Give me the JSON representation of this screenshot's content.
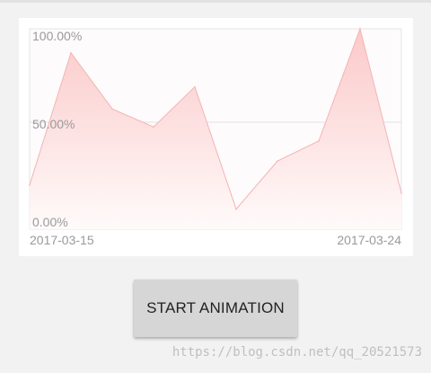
{
  "chart_data": {
    "type": "area",
    "x_labels": [
      "2017-03-15",
      "2017-03-24"
    ],
    "y_tick_labels": [
      "100.00%",
      "50.00%",
      "0.00%"
    ],
    "values_percent": [
      22,
      88,
      60,
      51,
      71,
      10,
      34,
      44,
      100,
      18
    ],
    "ylim": [
      0,
      100
    ],
    "grid": "horizontal",
    "colors": {
      "line": "#f4b4b4",
      "fill_top": "#fbc9c9",
      "fill_bottom": "#fffafa",
      "grid": "#e2e2e2",
      "axis_text": "#9a9a9a"
    }
  },
  "controls": {
    "start_label": "START ANIMATION"
  },
  "watermark": "https://blog.csdn.net/qq_20521573"
}
